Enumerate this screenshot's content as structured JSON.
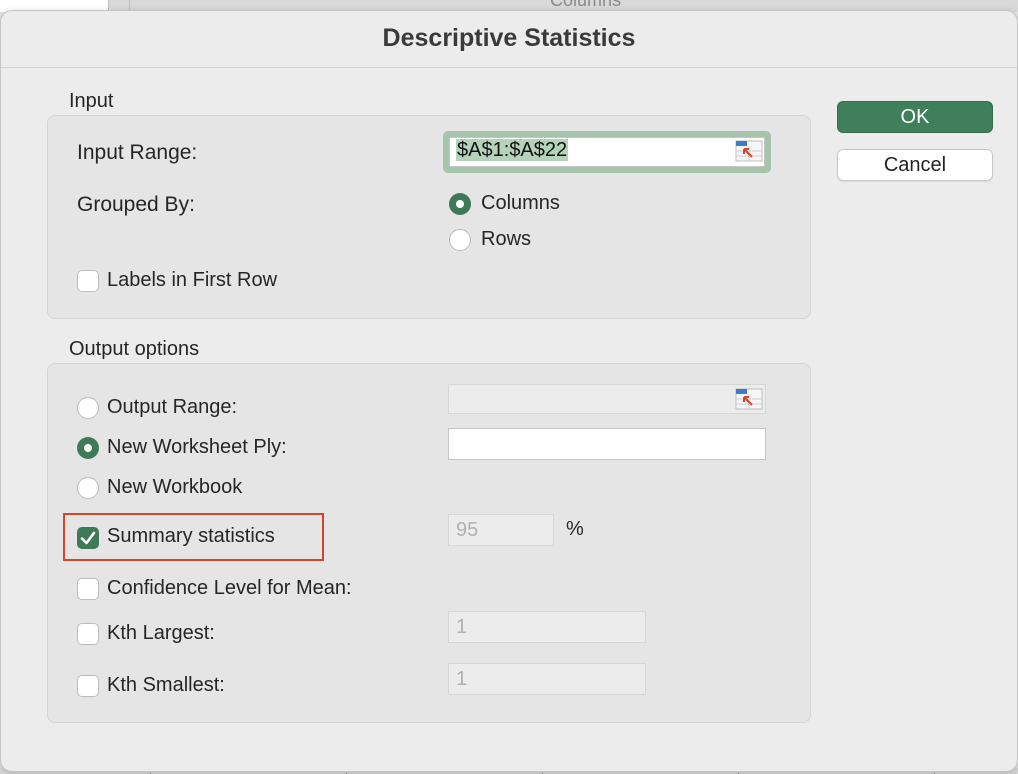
{
  "background": {
    "partial_column_text": "Columns"
  },
  "dialog": {
    "title": "Descriptive Statistics",
    "ok_label": "OK",
    "cancel_label": "Cancel"
  },
  "input": {
    "section_title": "Input",
    "input_range_label": "Input Range:",
    "input_range_value": "$A$1:$A$22",
    "grouped_by_label": "Grouped By:",
    "grouped_by_options": [
      "Columns",
      "Rows"
    ],
    "grouped_by_selected": "Columns",
    "labels_first_row_label": "Labels in First Row",
    "labels_first_row_checked": false
  },
  "output": {
    "section_title": "Output options",
    "output_range_label": "Output Range:",
    "output_range_value": "",
    "new_worksheet_label": "New Worksheet Ply:",
    "new_worksheet_value": "",
    "new_workbook_label": "New Workbook",
    "selected_option": "New Worksheet Ply:",
    "summary_statistics_label": "Summary statistics",
    "summary_statistics_checked": true,
    "confidence_value": "95",
    "percent_sign": "%",
    "confidence_label": "Confidence Level for Mean:",
    "confidence_checked": false,
    "kth_largest_label": "Kth Largest:",
    "kth_largest_value": "1",
    "kth_largest_checked": false,
    "kth_smallest_label": "Kth Smallest:",
    "kth_smallest_value": "1",
    "kth_smallest_checked": false
  },
  "colors": {
    "accent": "#3d7b57",
    "highlight_box": "#d4452e",
    "focus_ring": "#a6c4ac"
  },
  "icons": {
    "range_selector": "range-selector-icon",
    "checkmark": "checkmark-icon"
  }
}
